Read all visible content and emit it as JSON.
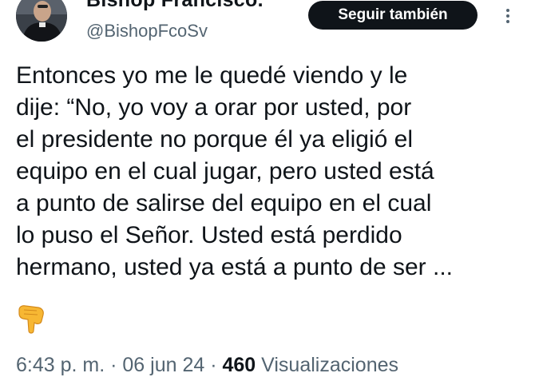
{
  "author": {
    "display_name": "Bishop Francisco.",
    "handle": "@BishopFcoSv"
  },
  "follow_button_label": "Seguir también",
  "more_icon": "more-vertical-icon",
  "tweet": {
    "lines": [
      "Entonces yo me le quedé viendo y le",
      "dije: “No, yo voy a orar por usted, por",
      "el presidente no porque él ya eligió el",
      "equipo en el cual jugar, pero usted está",
      "a punto de salirse del equipo en el cual",
      "lo puso el Señor. Usted está perdido",
      "hermano, usted ya está a punto de ser ..."
    ],
    "emoji": "pointing-down-hand-icon"
  },
  "meta": {
    "time": "6:43 p. m.",
    "sep1": " · ",
    "date": "06 jun 24",
    "sep2": " · ",
    "views_count": "460",
    "views_label": " Visualizaciones"
  },
  "colors": {
    "text": "#0f1419",
    "secondary": "#536471",
    "button_bg": "#0f1419",
    "button_text": "#ffffff"
  }
}
